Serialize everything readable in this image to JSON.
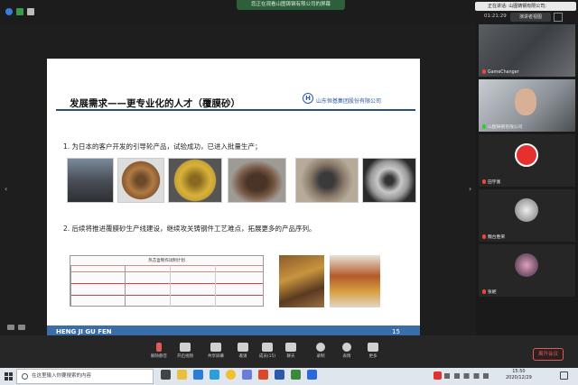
{
  "banner": {
    "text": "您正在观看山图铸钢有限公司的屏幕"
  },
  "speaking": {
    "text": "正在讲话: 山图铸钢有限公司;"
  },
  "meeting": {
    "time": "01:21:29",
    "view_mode": "演讲者视图"
  },
  "slide": {
    "title": "发展需求——更专业化的人才（覆膜砂）",
    "company": "山东恒基集团股份有限公司",
    "logo_letter": "H",
    "point1": "1. 为日本的客户开发的引导轮产品，试验成功，已进入批量生产；",
    "point2": "2. 后续将推进覆膜砂生产线建设，继续攻关铸钢件工艺难点，拓展更多的产品序列。",
    "table_title": "热芯盒制作试制计划",
    "footer": "HENG JI GU FEN",
    "page": "15"
  },
  "participants": [
    {
      "name": "GameChanger",
      "muted": true
    },
    {
      "name": "山图铸钢有限公司",
      "muted": false
    },
    {
      "name": "田宇富",
      "muted": true
    },
    {
      "name": "魏台胜荣",
      "muted": true
    },
    {
      "name": "张妮",
      "muted": true
    }
  ],
  "toolbar": {
    "mute": "解除静音",
    "video": "开启视频",
    "share": "共享屏幕",
    "invite": "邀请",
    "members": "成员(15)",
    "chat": "聊天",
    "record": "录制",
    "reactions": "表情",
    "more": "更多",
    "leave": "离开会议"
  },
  "taskbar": {
    "search_placeholder": "在这里输入你要搜索的内容",
    "time": "15:50",
    "date": "2020/12/29"
  },
  "colors": {
    "slide_blue": "#2b59a8",
    "footer_blue": "#3b6ea8",
    "leave_red": "#e05a5a",
    "banner_green": "#2e5f3b"
  }
}
